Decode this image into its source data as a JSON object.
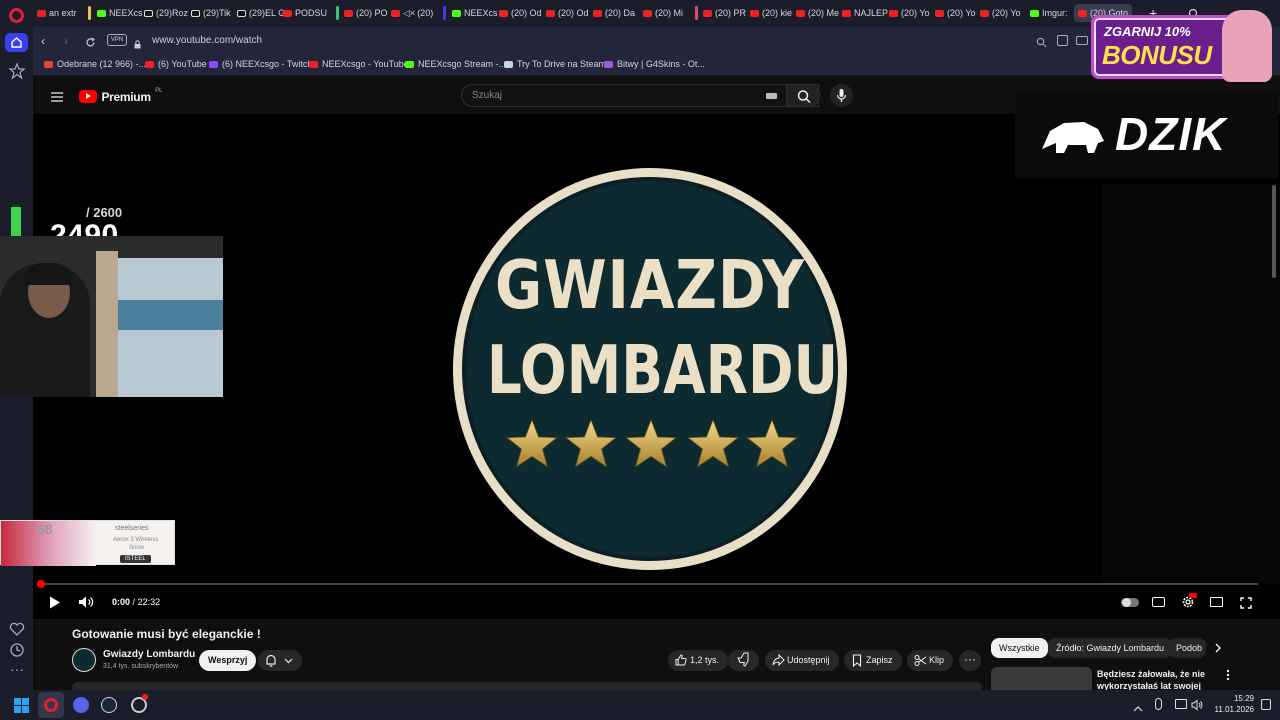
{
  "browser": {
    "tabs": [
      {
        "label": "an extr",
        "icon": "youtube"
      },
      {
        "label": "NEEXcs",
        "icon": "kick"
      },
      {
        "label": "(29)Roz",
        "icon": "tiktok"
      },
      {
        "label": "(29)Tik",
        "icon": "tiktok"
      },
      {
        "label": "(29)EL G",
        "icon": "tiktok"
      },
      {
        "label": "PODSU",
        "icon": "youtube"
      },
      {
        "label": "(20) PO",
        "icon": "youtube"
      },
      {
        "label": "(20)",
        "icon": "muted"
      },
      {
        "label": "NEEXcs",
        "icon": "kick"
      },
      {
        "label": "(20) Od",
        "icon": "youtube"
      },
      {
        "label": "(20) Od",
        "icon": "youtube"
      },
      {
        "label": "(20) Da",
        "icon": "youtube"
      },
      {
        "label": "(20) Mi",
        "icon": "youtube"
      },
      {
        "label": "(20) PR",
        "icon": "youtube"
      },
      {
        "label": "(20) kie",
        "icon": "youtube"
      },
      {
        "label": "(20) Me",
        "icon": "youtube"
      },
      {
        "label": "NAJLEP",
        "icon": "youtube"
      },
      {
        "label": "(20) Yo",
        "icon": "youtube"
      },
      {
        "label": "(20) Yo",
        "icon": "youtube"
      },
      {
        "label": "(20) Yo",
        "icon": "youtube"
      },
      {
        "label": "Imgur:",
        "icon": "imgur"
      },
      {
        "label": "(20) Goto",
        "icon": "youtube"
      }
    ],
    "url": "www.youtube.com/watch",
    "vpn_label": "VPN",
    "bookmarks": [
      {
        "label": "Odebrane (12 966) -...",
        "icon": "gmail"
      },
      {
        "label": "(6) YouTube",
        "icon": "youtube"
      },
      {
        "label": "(6) NEEXcsgo - Twitch",
        "icon": "twitch"
      },
      {
        "label": "NEEXcsgo - YouTube",
        "icon": "youtube"
      },
      {
        "label": "NEEXcsgo Stream -...",
        "icon": "kick"
      },
      {
        "label": "Try To Drive na Steam",
        "icon": "steam"
      },
      {
        "label": "Bitwy | G4Skins - Ot...",
        "icon": "g4skins"
      }
    ]
  },
  "youtube": {
    "logo_text": "Premium",
    "logo_region": "PL",
    "search_placeholder": "Szukaj"
  },
  "video": {
    "thumb_title_line1": "GWIAZDY",
    "thumb_title_line2": "LOMBARDU",
    "time_current": "0:00",
    "time_separator": "/",
    "time_total": "22:32",
    "progress": 0.0
  },
  "overlays": {
    "goal_total": "/ 2600",
    "goal_current": "2490",
    "goal_progress": 0.958,
    "promo_text_line1": "ZGARNIJ 10%",
    "promo_text_line2": "BONUSU",
    "sponsor_logo": "DZIK",
    "ad_brand": "steelseries",
    "ad_product_line1": "Aerox 3 Wireless",
    "ad_product_line2": "Snow",
    "ad_tag": "ISTEEL",
    "ad_number": "68"
  },
  "watch": {
    "title": "Gotowanie musi być eleganckie !",
    "channel_name": "Gwiazdy Lombardu",
    "subscribers": "31,4 tys. subskrybentów",
    "subscribe_label": "Wesprzyj",
    "likes": "1,2 tys.",
    "share_label": "Udostępnij",
    "save_label": "Zapisz",
    "clip_label": "Klip",
    "chips": [
      "Wszystkie",
      "Źródło: Gwiazdy Lombardu",
      "Podob"
    ],
    "recommended_title_line1": "Będziesz żałowała, że nie",
    "recommended_title_line2": "wykorzystałaś lat swojej"
  },
  "taskbar": {
    "time": "15:29",
    "date": "11.01.2026"
  }
}
